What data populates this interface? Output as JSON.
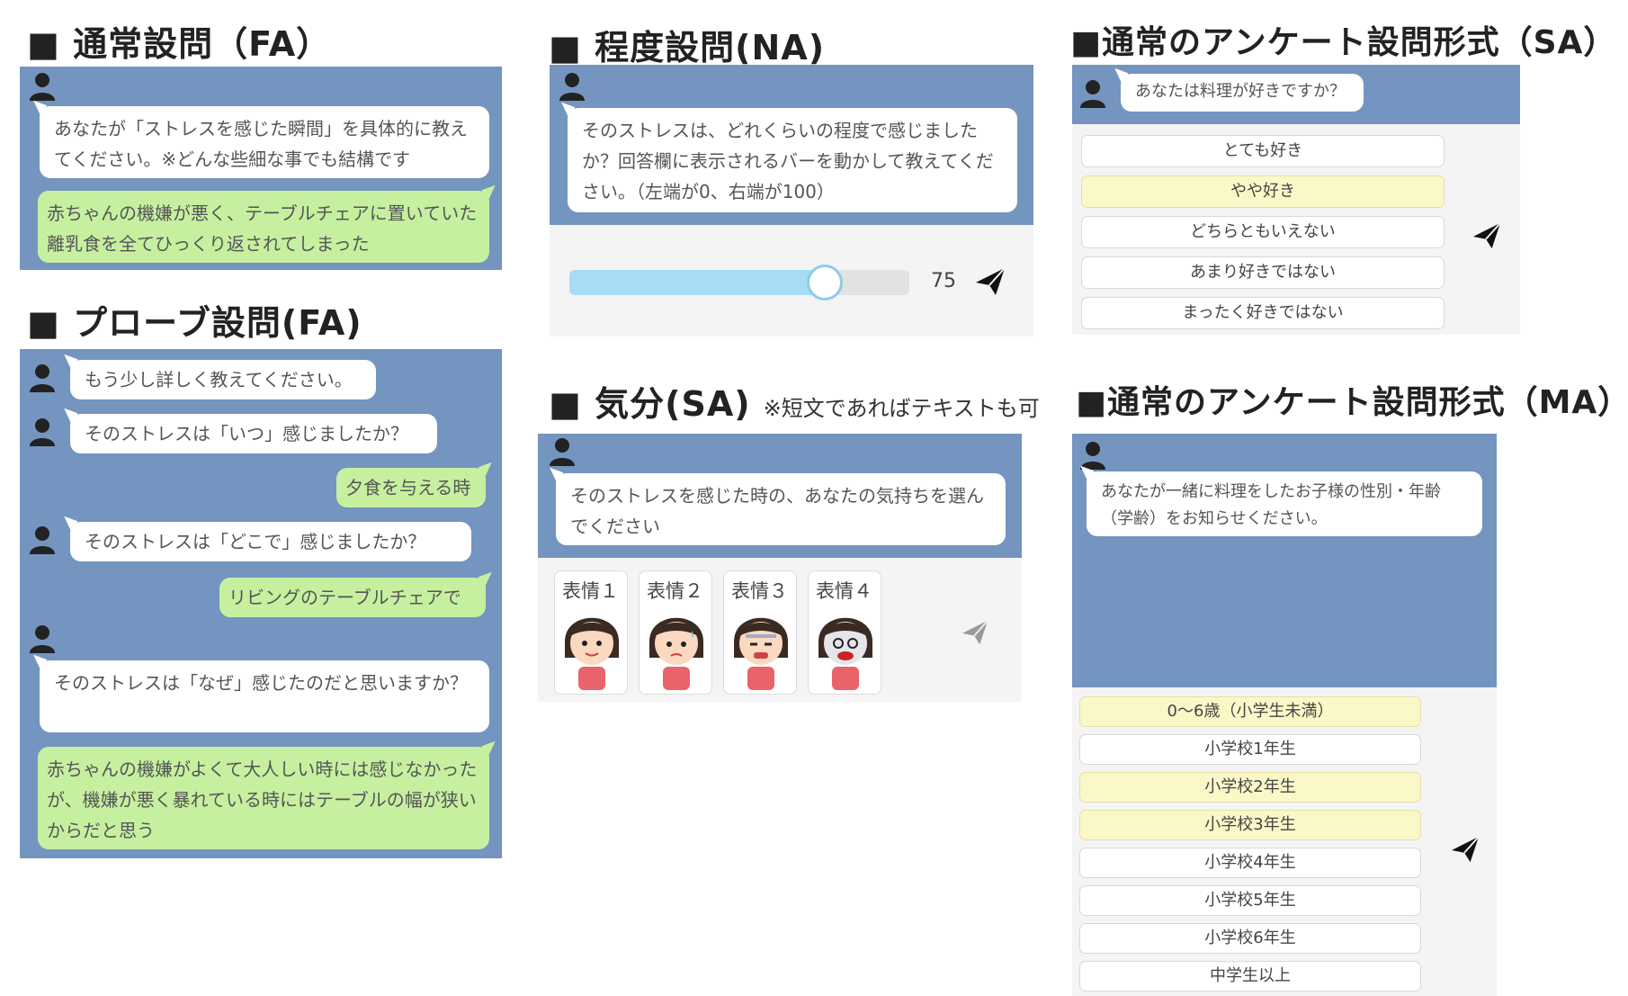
{
  "colors": {
    "panel": "#7395bf",
    "bubble": "#ffffff",
    "reply": "#c6f0a0",
    "selected": "#fbf8c8"
  },
  "icons": {
    "avatar": "person-icon",
    "send": "paper-plane-icon"
  },
  "sections": {
    "fa": {
      "title": "■ 通常設問（FA）",
      "question": "あなたが「ストレスを感じた瞬間」を具体的に教えてください。※どんな些細な事でも結構です",
      "answer": "赤ちゃんの機嫌が悪く、テーブルチェアに置いていた離乳食を全てひっくり返されてしまった"
    },
    "probe": {
      "title": "■ プローブ設問(FA)",
      "q1": "もう少し詳しく教えてください。",
      "q2": "そのストレスは「いつ」感じましたか？",
      "a2": "夕食を与える時",
      "q3": "そのストレスは「どこで」感じましたか？",
      "a3": "リビングのテーブルチェアで",
      "q4": "そのストレスは「なぜ」感じたのだと思いますか？",
      "a4": "赤ちゃんの機嫌がよくて大人しい時には感じなかったが、機嫌が悪く暴れている時にはテーブルの幅が狭いからだと思う"
    },
    "na": {
      "title": "■ 程度設問(NA)",
      "question": "そのストレスは、どれくらいの程度で感じましたか？回答欄に表示されるバーを動かして教えてください。（左端が0、右端が100）",
      "slider_min": 0,
      "slider_max": 100,
      "slider_value": 75,
      "value_label": "75"
    },
    "mood": {
      "title": "■ 気分(SA)",
      "note": "※短文であればテキストも可",
      "question": "そのストレスを感じた時の、あなたの気持ちを選んでください",
      "faces": [
        "表情１",
        "表情２",
        "表情３",
        "表情４"
      ]
    },
    "sa": {
      "title": "■通常のアンケート設問形式（SA）",
      "question": "あなたは料理が好きですか？",
      "options": [
        {
          "label": "とても好き",
          "selected": false
        },
        {
          "label": "やや好き",
          "selected": true
        },
        {
          "label": "どちらともいえない",
          "selected": false
        },
        {
          "label": "あまり好きではない",
          "selected": false
        },
        {
          "label": "まったく好きではない",
          "selected": false
        }
      ]
    },
    "ma": {
      "title": "■通常のアンケート設問形式（MA）",
      "question": "あなたが一緒に料理をしたお子様の性別・年齢（学齢）をお知らせください。",
      "options": [
        {
          "label": "0〜6歳（小学生未満）",
          "selected": true
        },
        {
          "label": "小学校1年生",
          "selected": false
        },
        {
          "label": "小学校2年生",
          "selected": true
        },
        {
          "label": "小学校3年生",
          "selected": true
        },
        {
          "label": "小学校4年生",
          "selected": false
        },
        {
          "label": "小学校5年生",
          "selected": false
        },
        {
          "label": "小学校6年生",
          "selected": false
        },
        {
          "label": "中学生以上",
          "selected": false
        }
      ]
    }
  }
}
